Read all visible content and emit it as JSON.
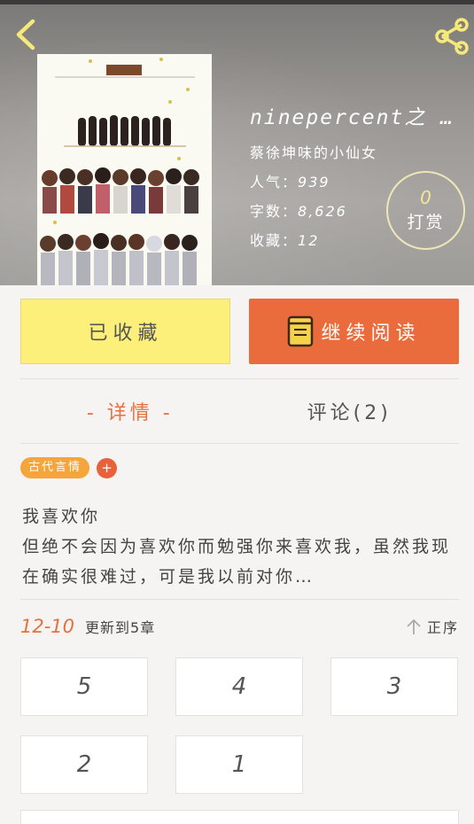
{
  "header": {
    "back_icon": "chevron-left-icon",
    "share_icon": "share-icon"
  },
  "book": {
    "title": "ninepercent之 …",
    "author": "蔡徐坤味的小仙女",
    "popularity_label": "人气：",
    "popularity_value": "939",
    "words_label": "字数：",
    "words_value": "8,626",
    "favorites_label": "收藏：",
    "favorites_value": "12"
  },
  "tip": {
    "count": "0",
    "label": "打赏"
  },
  "actions": {
    "collected_label": "已收藏",
    "read_label": "继续阅读",
    "read_icon": "book-icon"
  },
  "tabs": {
    "detail_label": "- 详情 -",
    "comments_label": "评论(2)"
  },
  "tags": {
    "genre": "古代言情",
    "add": "+"
  },
  "description": {
    "line1": "我喜欢你",
    "body": "但绝不会因为喜欢你而勉强你来喜欢我，虽然我现在确实很难过，可是我以前对你…"
  },
  "update": {
    "date": "12-10",
    "text": "更新到5章",
    "sort_label": "正序",
    "sort_icon": "arrow-up-icon"
  },
  "chapters": [
    "5",
    "4",
    "3",
    "2",
    "1"
  ],
  "colors": {
    "accent": "#e8703e",
    "read_button": "#ea6b3c",
    "collected_button": "#fdf07a",
    "tag": "#f6a53b"
  }
}
